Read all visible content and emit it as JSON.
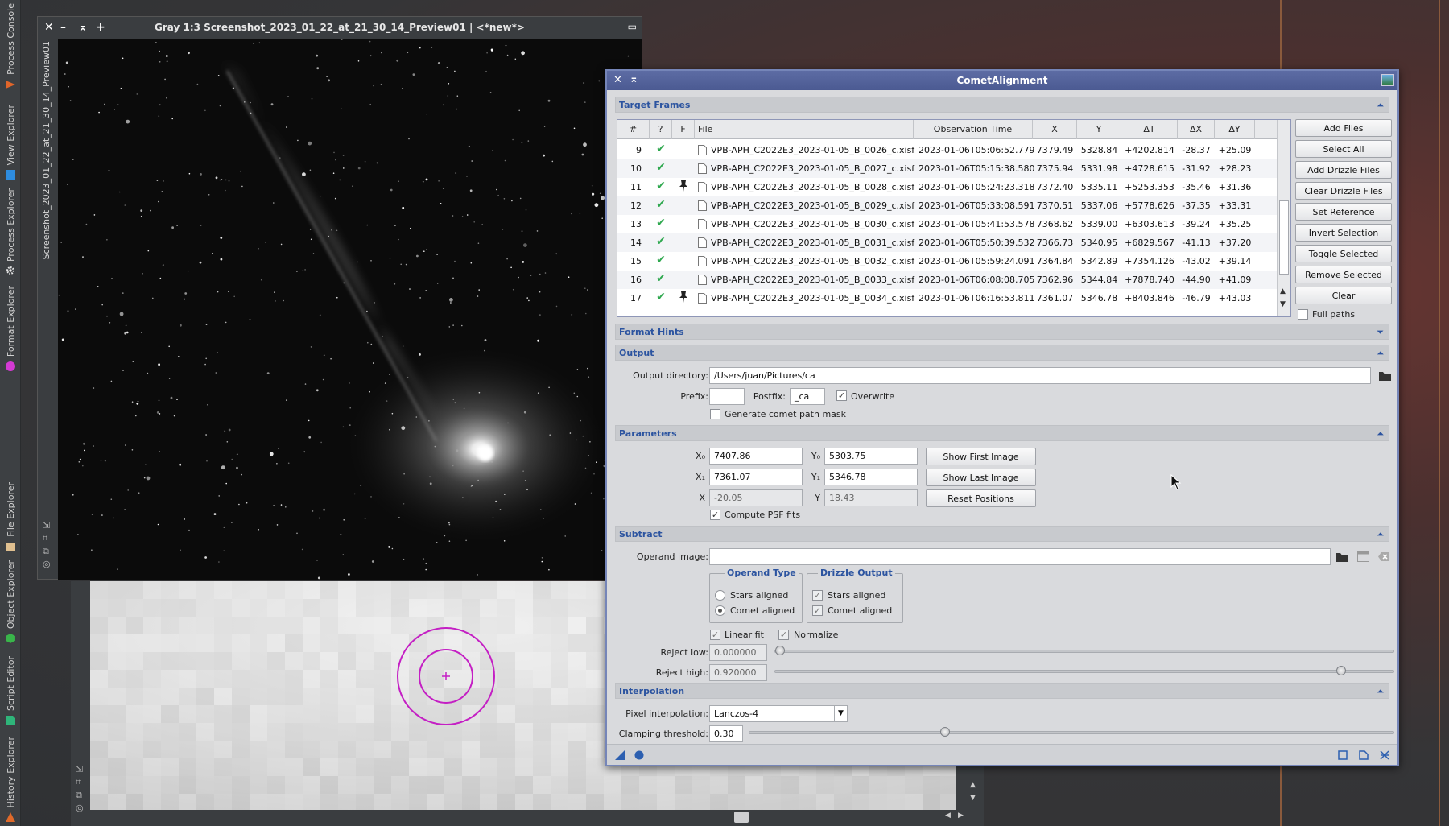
{
  "side_panel": {
    "tabs": [
      {
        "label": "Process Console",
        "icon": "console-icon",
        "color": "#e0652a"
      },
      {
        "label": "View Explorer",
        "icon": "view-icon",
        "color": "#2e8de0"
      },
      {
        "label": "Process Explorer",
        "icon": "gear-icon",
        "color": "#e8e8e8"
      },
      {
        "label": "Format Explorer",
        "icon": "format-icon",
        "color": "#d43ad4"
      },
      {
        "label": "File Explorer",
        "icon": "folder-icon",
        "color": "#e0c090"
      },
      {
        "label": "Object Explorer",
        "icon": "cube-icon",
        "color": "#39b54a"
      },
      {
        "label": "Script Editor",
        "icon": "script-icon",
        "color": "#2fb57a"
      },
      {
        "label": "History Explorer",
        "icon": "history-icon",
        "color": "#e06a2a"
      }
    ]
  },
  "image_window": {
    "title": "Gray 1:3 Screenshot_2023_01_22_at_21_30_14_Preview01 | <*new*>",
    "vertical_label": "Screenshot_2023_01_22_at_21_30_14_Preview01"
  },
  "dialog": {
    "title": "CometAlignment",
    "target_frames": {
      "section_title": "Target Frames",
      "columns": [
        "#",
        "?",
        "F",
        "File",
        "Observation Time",
        "X",
        "Y",
        "ΔT",
        "ΔX",
        "ΔY"
      ],
      "rows": [
        {
          "n": "9",
          "file": "VPB-APH_C2022E3_2023-01-05_B_0026_c.xisf",
          "time": "2023-01-06T05:06:52.779",
          "x": "7379.49",
          "y": "5328.84",
          "dt": "+4202.814",
          "dx": "-28.37",
          "dy": "+25.09",
          "pinned": false
        },
        {
          "n": "10",
          "file": "VPB-APH_C2022E3_2023-01-05_B_0027_c.xisf",
          "time": "2023-01-06T05:15:38.580",
          "x": "7375.94",
          "y": "5331.98",
          "dt": "+4728.615",
          "dx": "-31.92",
          "dy": "+28.23",
          "pinned": false
        },
        {
          "n": "11",
          "file": "VPB-APH_C2022E3_2023-01-05_B_0028_c.xisf",
          "time": "2023-01-06T05:24:23.318",
          "x": "7372.40",
          "y": "5335.11",
          "dt": "+5253.353",
          "dx": "-35.46",
          "dy": "+31.36",
          "pinned": true
        },
        {
          "n": "12",
          "file": "VPB-APH_C2022E3_2023-01-05_B_0029_c.xisf",
          "time": "2023-01-06T05:33:08.591",
          "x": "7370.51",
          "y": "5337.06",
          "dt": "+5778.626",
          "dx": "-37.35",
          "dy": "+33.31",
          "pinned": false
        },
        {
          "n": "13",
          "file": "VPB-APH_C2022E3_2023-01-05_B_0030_c.xisf",
          "time": "2023-01-06T05:41:53.578",
          "x": "7368.62",
          "y": "5339.00",
          "dt": "+6303.613",
          "dx": "-39.24",
          "dy": "+35.25",
          "pinned": false
        },
        {
          "n": "14",
          "file": "VPB-APH_C2022E3_2023-01-05_B_0031_c.xisf",
          "time": "2023-01-06T05:50:39.532",
          "x": "7366.73",
          "y": "5340.95",
          "dt": "+6829.567",
          "dx": "-41.13",
          "dy": "+37.20",
          "pinned": false
        },
        {
          "n": "15",
          "file": "VPB-APH_C2022E3_2023-01-05_B_0032_c.xisf",
          "time": "2023-01-06T05:59:24.091",
          "x": "7364.84",
          "y": "5342.89",
          "dt": "+7354.126",
          "dx": "-43.02",
          "dy": "+39.14",
          "pinned": false
        },
        {
          "n": "16",
          "file": "VPB-APH_C2022E3_2023-01-05_B_0033_c.xisf",
          "time": "2023-01-06T06:08:08.705",
          "x": "7362.96",
          "y": "5344.84",
          "dt": "+7878.740",
          "dx": "-44.90",
          "dy": "+41.09",
          "pinned": false
        },
        {
          "n": "17",
          "file": "VPB-APH_C2022E3_2023-01-05_B_0034_c.xisf",
          "time": "2023-01-06T06:16:53.811",
          "x": "7361.07",
          "y": "5346.78",
          "dt": "+8403.846",
          "dx": "-46.79",
          "dy": "+43.03",
          "pinned": true
        }
      ],
      "buttons": [
        "Add Files",
        "Select All",
        "Add Drizzle Files",
        "Clear Drizzle Files",
        "Set Reference",
        "Invert Selection",
        "Toggle Selected",
        "Remove Selected",
        "Clear"
      ],
      "full_paths_label": "Full paths"
    },
    "format_hints": {
      "section_title": "Format Hints"
    },
    "output": {
      "section_title": "Output",
      "dir_label": "Output directory:",
      "dir_value": "/Users/juan/Pictures/ca",
      "prefix_label": "Prefix:",
      "prefix_value": "",
      "postfix_label": "Postfix:",
      "postfix_value": "_ca",
      "overwrite_label": "Overwrite",
      "overwrite_checked": true,
      "mask_label": "Generate comet path mask",
      "mask_checked": false
    },
    "parameters": {
      "section_title": "Parameters",
      "x0_label": "X₀",
      "x0": "7407.86",
      "y0_label": "Y₀",
      "y0": "5303.75",
      "x1_label": "X₁",
      "x1": "7361.07",
      "y1_label": "Y₁",
      "y1": "5346.78",
      "dx_label": "X",
      "dx": "-20.05",
      "dy_label": "Y",
      "dy": "18.43",
      "show_first": "Show First Image",
      "show_last": "Show Last Image",
      "reset": "Reset Positions",
      "psf_label": "Compute PSF fits",
      "psf_checked": true
    },
    "subtract": {
      "section_title": "Subtract",
      "operand_label": "Operand image:",
      "operand_value": "",
      "operand_type_title": "Operand Type",
      "stars_aligned": "Stars aligned",
      "comet_aligned": "Comet aligned",
      "drizzle_title": "Drizzle Output",
      "d_stars": "Stars aligned",
      "d_comet": "Comet aligned",
      "linear_fit": "Linear fit",
      "normalize": "Normalize",
      "reject_low_label": "Reject low:",
      "reject_low": "0.000000",
      "reject_low_fraction": 0.0,
      "reject_high_label": "Reject high:",
      "reject_high": "0.920000",
      "reject_high_fraction": 0.92
    },
    "interpolation": {
      "section_title": "Interpolation",
      "pixel_label": "Pixel interpolation:",
      "pixel_value": "Lanczos-4",
      "clamp_label": "Clamping threshold:",
      "clamp_value": "0.30",
      "clamp_fraction": 0.3
    }
  }
}
